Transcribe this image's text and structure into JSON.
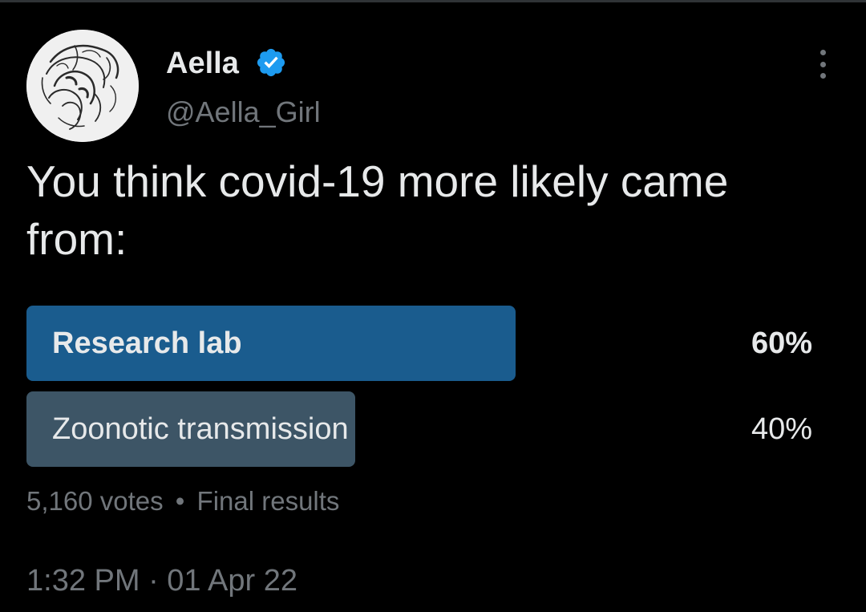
{
  "author": {
    "display_name": "Aella",
    "handle": "@Aella_Girl",
    "verified": true
  },
  "tweet": {
    "text": "You think covid-19 more likely came from:"
  },
  "poll": {
    "options": [
      {
        "label": "Research lab",
        "percent": "60%",
        "fraction": 0.6,
        "winner": true
      },
      {
        "label": "Zoonotic transmission",
        "percent": "40%",
        "fraction": 0.4,
        "winner": false
      }
    ],
    "votes": "5,160 votes",
    "separator": "•",
    "status": "Final results"
  },
  "timestamp": "1:32 PM · 01 Apr 22",
  "colors": {
    "background": "#000000",
    "winner_bar": "#1a5c8e",
    "other_bar": "#3d5566",
    "primary_text": "#e7e9ea",
    "secondary_text": "#71767b",
    "verified_badge": "#1d9bf0"
  },
  "icons": {
    "verified": "verified-badge-icon",
    "more": "more-vertical-icon"
  }
}
